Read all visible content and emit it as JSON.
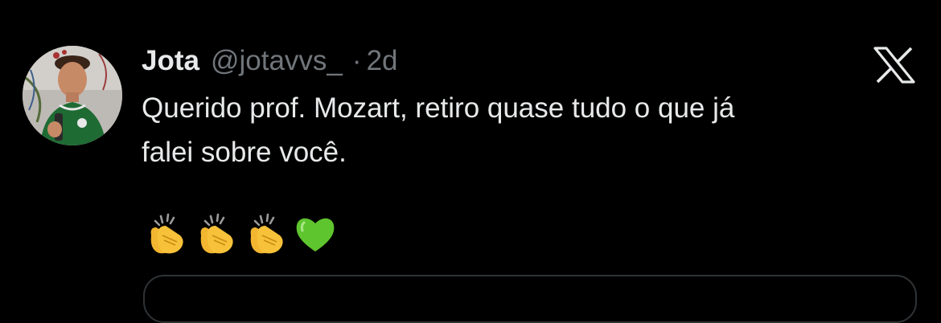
{
  "tweet": {
    "author_name": "Jota",
    "author_handle": "@jotavvs_",
    "separator": "·",
    "timestamp": "2d",
    "text_line1": "Querido prof. Mozart, retiro quase tudo o que já",
    "text_line2": "falei sobre você.",
    "emojis": [
      "clapping-hands",
      "clapping-hands",
      "clapping-hands",
      "green-heart"
    ]
  },
  "icons": {
    "platform_logo": "x-logo"
  },
  "colors": {
    "background": "#000000",
    "primary_text": "#e7e9ea",
    "secondary_text": "#71767b",
    "border": "#2f3336",
    "emoji_yellow": "#f7c239",
    "emoji_green": "#5fc52e"
  }
}
